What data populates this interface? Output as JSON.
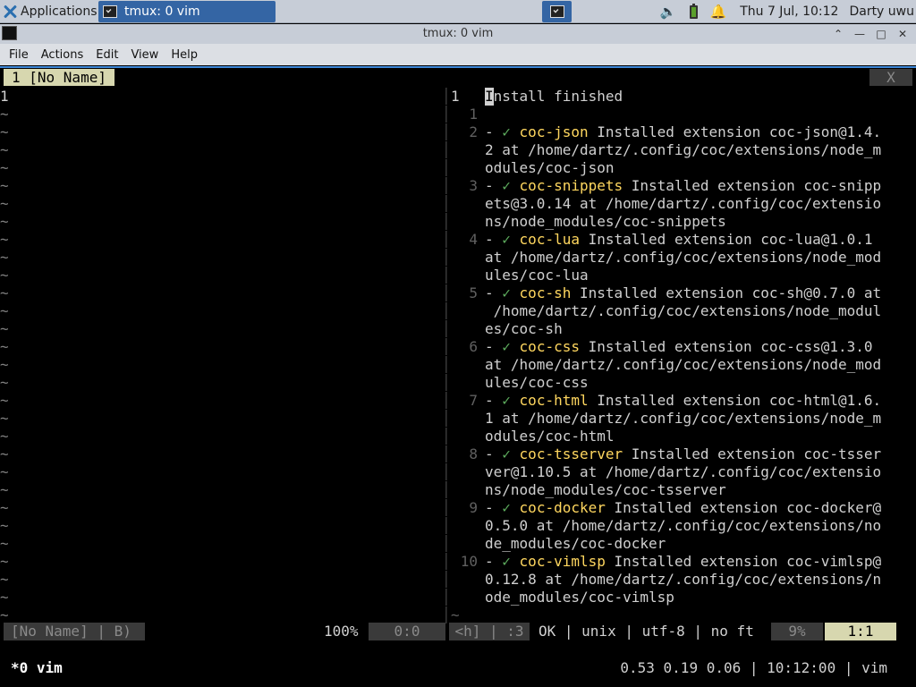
{
  "panel": {
    "applications_label": "Applications",
    "applications_sep": "≡",
    "task_label": "tmux: 0 vim",
    "clock": "Thu  7 Jul, 10:12",
    "user": "Darty uwu",
    "icons": [
      "xfce-logo-icon",
      "terminal-icon",
      "volume-icon",
      "battery-icon",
      "bell-icon"
    ]
  },
  "window": {
    "title": "tmux: 0 vim",
    "menu": [
      "File",
      "Actions",
      "Edit",
      "View",
      "Help"
    ]
  },
  "vim": {
    "tab_label": "1 [No Name]",
    "tab_close": "X",
    "left_first_line": "1",
    "tilde": "~",
    "right_lines": [
      {
        "num": "1",
        "current": true,
        "segments": [
          {
            "t": "I",
            "c": "cursor"
          },
          {
            "t": "nstall finished",
            "c": "txt"
          }
        ]
      },
      {
        "num": "1",
        "segments": []
      },
      {
        "num": "2",
        "segments": [
          {
            "t": "- ",
            "c": "txt"
          },
          {
            "t": "✓",
            "c": "check"
          },
          {
            "t": " ",
            "c": "txt"
          },
          {
            "t": "coc-json",
            "c": "ext"
          },
          {
            "t": " Installed extension coc-json@1.4.",
            "c": "txt"
          }
        ]
      },
      {
        "num": "",
        "segments": [
          {
            "t": "2 at /home/dartz/.config/coc/extensions/node_m",
            "c": "txt"
          }
        ]
      },
      {
        "num": "",
        "segments": [
          {
            "t": "odules/coc-json",
            "c": "txt"
          }
        ]
      },
      {
        "num": "3",
        "segments": [
          {
            "t": "- ",
            "c": "txt"
          },
          {
            "t": "✓",
            "c": "check"
          },
          {
            "t": " ",
            "c": "txt"
          },
          {
            "t": "coc-snippets",
            "c": "ext"
          },
          {
            "t": " Installed extension coc-snipp",
            "c": "txt"
          }
        ]
      },
      {
        "num": "",
        "segments": [
          {
            "t": "ets@3.0.14 at /home/dartz/.config/coc/extensio",
            "c": "txt"
          }
        ]
      },
      {
        "num": "",
        "segments": [
          {
            "t": "ns/node_modules/coc-snippets",
            "c": "txt"
          }
        ]
      },
      {
        "num": "4",
        "segments": [
          {
            "t": "- ",
            "c": "txt"
          },
          {
            "t": "✓",
            "c": "check"
          },
          {
            "t": " ",
            "c": "txt"
          },
          {
            "t": "coc-lua",
            "c": "ext"
          },
          {
            "t": " Installed extension coc-lua@1.0.1",
            "c": "txt"
          }
        ]
      },
      {
        "num": "",
        "segments": [
          {
            "t": "at /home/dartz/.config/coc/extensions/node_mod",
            "c": "txt"
          }
        ]
      },
      {
        "num": "",
        "segments": [
          {
            "t": "ules/coc-lua",
            "c": "txt"
          }
        ]
      },
      {
        "num": "5",
        "segments": [
          {
            "t": "- ",
            "c": "txt"
          },
          {
            "t": "✓",
            "c": "check"
          },
          {
            "t": " ",
            "c": "txt"
          },
          {
            "t": "coc-sh",
            "c": "ext"
          },
          {
            "t": " Installed extension coc-sh@0.7.0 at",
            "c": "txt"
          }
        ]
      },
      {
        "num": "",
        "segments": [
          {
            "t": " /home/dartz/.config/coc/extensions/node_modul",
            "c": "txt"
          }
        ]
      },
      {
        "num": "",
        "segments": [
          {
            "t": "es/coc-sh",
            "c": "txt"
          }
        ]
      },
      {
        "num": "6",
        "segments": [
          {
            "t": "- ",
            "c": "txt"
          },
          {
            "t": "✓",
            "c": "check"
          },
          {
            "t": " ",
            "c": "txt"
          },
          {
            "t": "coc-css",
            "c": "ext"
          },
          {
            "t": " Installed extension coc-css@1.3.0",
            "c": "txt"
          }
        ]
      },
      {
        "num": "",
        "segments": [
          {
            "t": "at /home/dartz/.config/coc/extensions/node_mod",
            "c": "txt"
          }
        ]
      },
      {
        "num": "",
        "segments": [
          {
            "t": "ules/coc-css",
            "c": "txt"
          }
        ]
      },
      {
        "num": "7",
        "segments": [
          {
            "t": "- ",
            "c": "txt"
          },
          {
            "t": "✓",
            "c": "check"
          },
          {
            "t": " ",
            "c": "txt"
          },
          {
            "t": "coc-html",
            "c": "ext"
          },
          {
            "t": " Installed extension coc-html@1.6.",
            "c": "txt"
          }
        ]
      },
      {
        "num": "",
        "segments": [
          {
            "t": "1 at /home/dartz/.config/coc/extensions/node_m",
            "c": "txt"
          }
        ]
      },
      {
        "num": "",
        "segments": [
          {
            "t": "odules/coc-html",
            "c": "txt"
          }
        ]
      },
      {
        "num": "8",
        "segments": [
          {
            "t": "- ",
            "c": "txt"
          },
          {
            "t": "✓",
            "c": "check"
          },
          {
            "t": " ",
            "c": "txt"
          },
          {
            "t": "coc-tsserver",
            "c": "ext"
          },
          {
            "t": " Installed extension coc-tsser",
            "c": "txt"
          }
        ]
      },
      {
        "num": "",
        "segments": [
          {
            "t": "ver@1.10.5 at /home/dartz/.config/coc/extensio",
            "c": "txt"
          }
        ]
      },
      {
        "num": "",
        "segments": [
          {
            "t": "ns/node_modules/coc-tsserver",
            "c": "txt"
          }
        ]
      },
      {
        "num": "9",
        "segments": [
          {
            "t": "- ",
            "c": "txt"
          },
          {
            "t": "✓",
            "c": "check"
          },
          {
            "t": " ",
            "c": "txt"
          },
          {
            "t": "coc-docker",
            "c": "ext"
          },
          {
            "t": " Installed extension coc-docker@",
            "c": "txt"
          }
        ]
      },
      {
        "num": "",
        "segments": [
          {
            "t": "0.5.0 at /home/dartz/.config/coc/extensions/no",
            "c": "txt"
          }
        ]
      },
      {
        "num": "",
        "segments": [
          {
            "t": "de_modules/coc-docker",
            "c": "txt"
          }
        ]
      },
      {
        "num": "10",
        "segments": [
          {
            "t": "- ",
            "c": "txt"
          },
          {
            "t": "✓",
            "c": "check"
          },
          {
            "t": " ",
            "c": "txt"
          },
          {
            "t": "coc-vimlsp",
            "c": "ext"
          },
          {
            "t": " Installed extension coc-vimlsp@",
            "c": "txt"
          }
        ]
      },
      {
        "num": "",
        "segments": [
          {
            "t": "0.12.8 at /home/dartz/.config/coc/extensions/n",
            "c": "txt"
          }
        ]
      },
      {
        "num": "",
        "segments": [
          {
            "t": "ode_modules/coc-vimlsp",
            "c": "txt"
          }
        ]
      }
    ],
    "right_end_tilde": "~",
    "status": {
      "file": "[No Name] | B)",
      "percent": "100%",
      "position": "0:0",
      "buffer": "<h] | :3",
      "info": "OK | unix | utf-8 | no ft",
      "percent2": "9%",
      "position2": "1:1"
    }
  },
  "tmux": {
    "window_label": "*0 vim",
    "right_status": "0.53 0.19 0.06 | 10:12:00 | vim"
  },
  "colors": {
    "extension_name": "#ffd75f",
    "check": "#5faf5f",
    "tab_active_bg": "#d7d7af",
    "panel_bg": "#c7cdd7",
    "task_bg": "#3465a4"
  }
}
